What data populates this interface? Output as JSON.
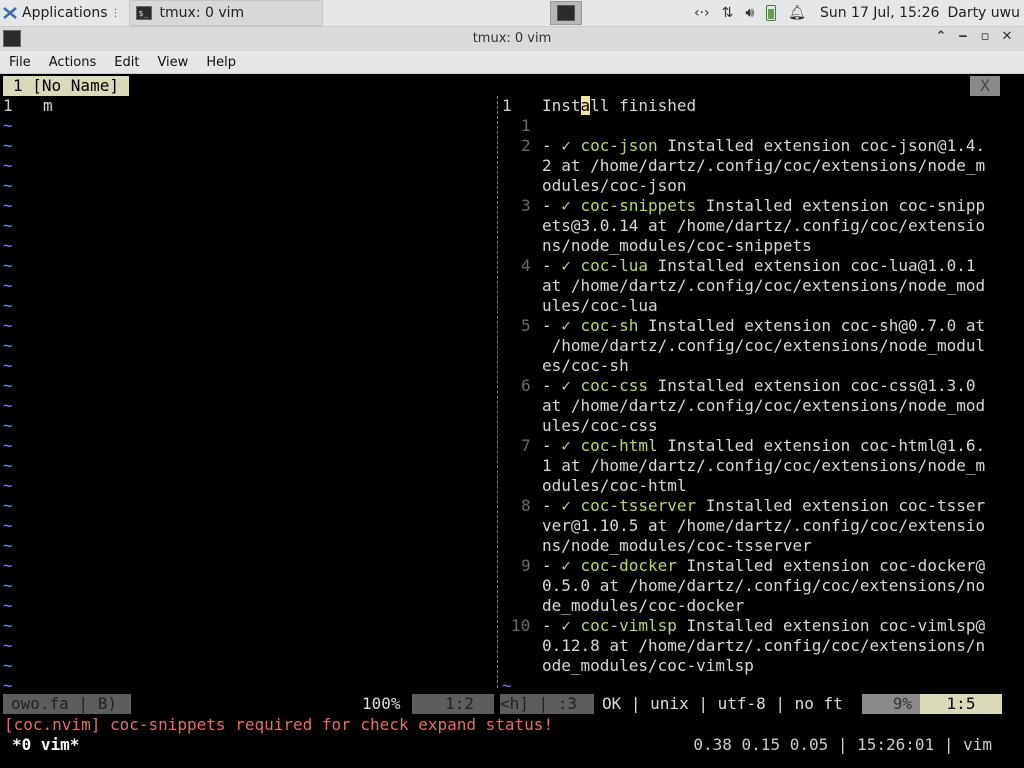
{
  "panel": {
    "applications_label": "Applications",
    "task_label": "tmux: 0 vim",
    "clock": "Sun 17 Jul, 15:26",
    "user": "Darty uwu"
  },
  "window": {
    "title": "tmux: 0 vim",
    "menu": [
      "File",
      "Actions",
      "Edit",
      "View",
      "Help"
    ]
  },
  "vim": {
    "tab_label": "1 [No Name]",
    "tab_close": "X",
    "left": {
      "line_number": "1",
      "line_text": "m",
      "tilde": "~"
    },
    "right": {
      "header_num": "1",
      "header_text_pre": "Inst",
      "header_text_cursor": "a",
      "header_text_post": "ll finished",
      "blank_num": "1",
      "entries": [
        {
          "num": "2",
          "name": "coc-json",
          "lines": [
            " Installed extension coc-json@1.4.",
            "2 at /home/dartz/.config/coc/extensions/node_m",
            "odules/coc-json"
          ]
        },
        {
          "num": "3",
          "name": "coc-snippets",
          "lines": [
            " Installed extension coc-snipp",
            "ets@3.0.14 at /home/dartz/.config/coc/extensio",
            "ns/node_modules/coc-snippets"
          ]
        },
        {
          "num": "4",
          "name": "coc-lua",
          "lines": [
            " Installed extension coc-lua@1.0.1",
            "at /home/dartz/.config/coc/extensions/node_mod",
            "ules/coc-lua"
          ]
        },
        {
          "num": "5",
          "name": "coc-sh",
          "lines": [
            " Installed extension coc-sh@0.7.0 at",
            " /home/dartz/.config/coc/extensions/node_modul",
            "es/coc-sh"
          ]
        },
        {
          "num": "6",
          "name": "coc-css",
          "lines": [
            " Installed extension coc-css@1.3.0",
            "at /home/dartz/.config/coc/extensions/node_mod",
            "ules/coc-css"
          ]
        },
        {
          "num": "7",
          "name": "coc-html",
          "lines": [
            " Installed extension coc-html@1.6.",
            "1 at /home/dartz/.config/coc/extensions/node_m",
            "odules/coc-html"
          ]
        },
        {
          "num": "8",
          "name": "coc-tsserver",
          "lines": [
            " Installed extension coc-tsser",
            "ver@1.10.5 at /home/dartz/.config/coc/extensio",
            "ns/node_modules/coc-tsserver"
          ]
        },
        {
          "num": "9",
          "name": "coc-docker",
          "lines": [
            " Installed extension coc-docker@",
            "0.5.0 at /home/dartz/.config/coc/extensions/no",
            "de_modules/coc-docker"
          ]
        },
        {
          "num": "10",
          "name": "coc-vimlsp",
          "lines": [
            " Installed extension coc-vimlsp@",
            "0.12.8 at /home/dartz/.config/coc/extensions/n",
            "ode_modules/coc-vimlsp"
          ]
        }
      ],
      "bullet": "- ",
      "check": "✓ ",
      "tail_tilde": "~"
    },
    "status": {
      "left_file": "owo.fa | B)",
      "left_percent": "100%",
      "left_pos": "1:2",
      "right_mode": "<h] | :3",
      "right_info": "OK | unix | utf-8 | no ft",
      "right_percent": "9%",
      "right_pos": "1:5"
    },
    "message": "[coc.nvim] coc-snippets required for check expand status!"
  },
  "tmux": {
    "window": "*0 vim*",
    "right": "0.38 0.15 0.05 | 15:26:01 | vim"
  }
}
